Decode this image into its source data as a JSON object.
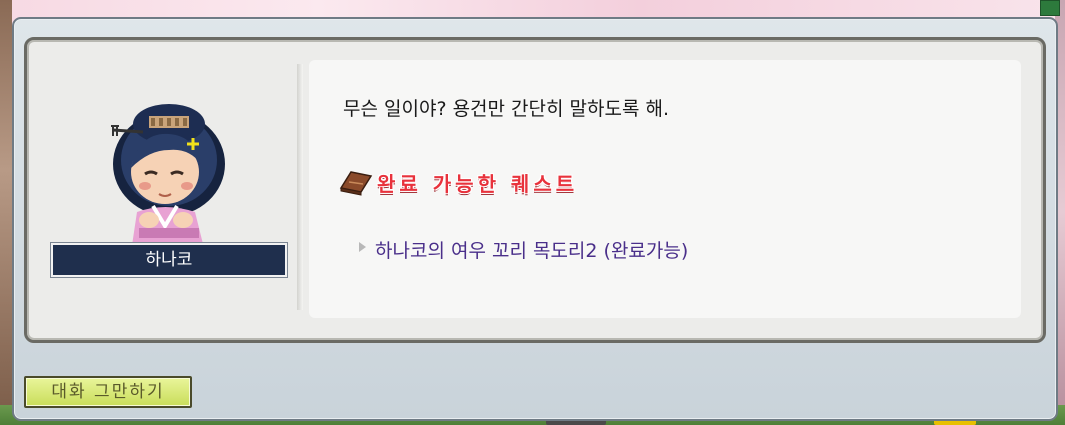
{
  "dialog": {
    "npc_name": "하나코",
    "message": "무슨 일이야? 용건만 간단히 말하도록 해.",
    "quest_section_label": "완료 가능한 퀘스트",
    "quest_items": [
      {
        "label": "하나코의 여우 꼬리 목도리2 (완료가능)"
      }
    ],
    "end_button_label": "대화 그만하기"
  },
  "colors": {
    "quest_header": "#e8323c",
    "quest_item": "#4a2f8a",
    "name_plate": "#1f2f4d",
    "end_button": "#c9dd5a"
  },
  "icons": {
    "quest_section": "quest-book-icon",
    "quest_item_bullet": "triangle-right-icon"
  }
}
